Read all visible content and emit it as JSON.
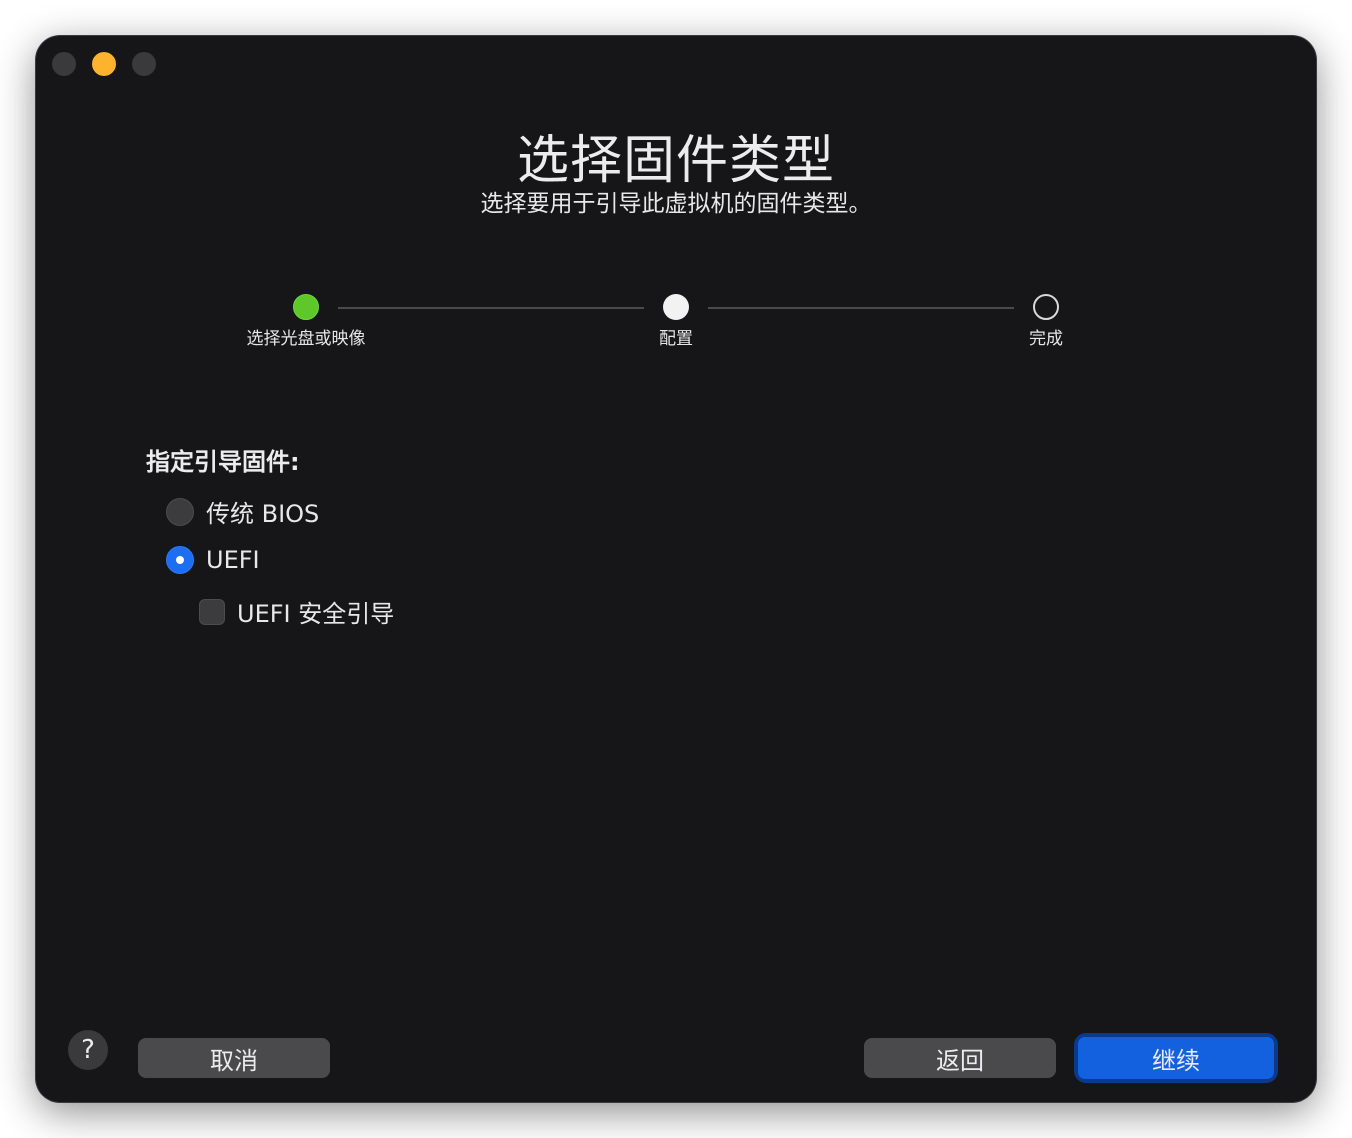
{
  "window": {
    "title": "选择固件类型",
    "subtitle": "选择要用于引导此虚拟机的固件类型。"
  },
  "steps": [
    {
      "label": "选择光盘或映像",
      "state": "done"
    },
    {
      "label": "配置",
      "state": "current"
    },
    {
      "label": "完成",
      "state": "todo"
    }
  ],
  "firmware": {
    "section_label": "指定引导固件:",
    "options": [
      {
        "label": "传统 BIOS",
        "selected": false
      },
      {
        "label": "UEFI",
        "selected": true
      }
    ],
    "secure_boot": {
      "label": "UEFI 安全引导",
      "checked": false
    }
  },
  "footer": {
    "help_label": "?",
    "cancel_label": "取消",
    "back_label": "返回",
    "continue_label": "继续"
  },
  "colors": {
    "window_bg": "#161618",
    "step_done": "#5ec72a",
    "accent": "#1461e0"
  }
}
